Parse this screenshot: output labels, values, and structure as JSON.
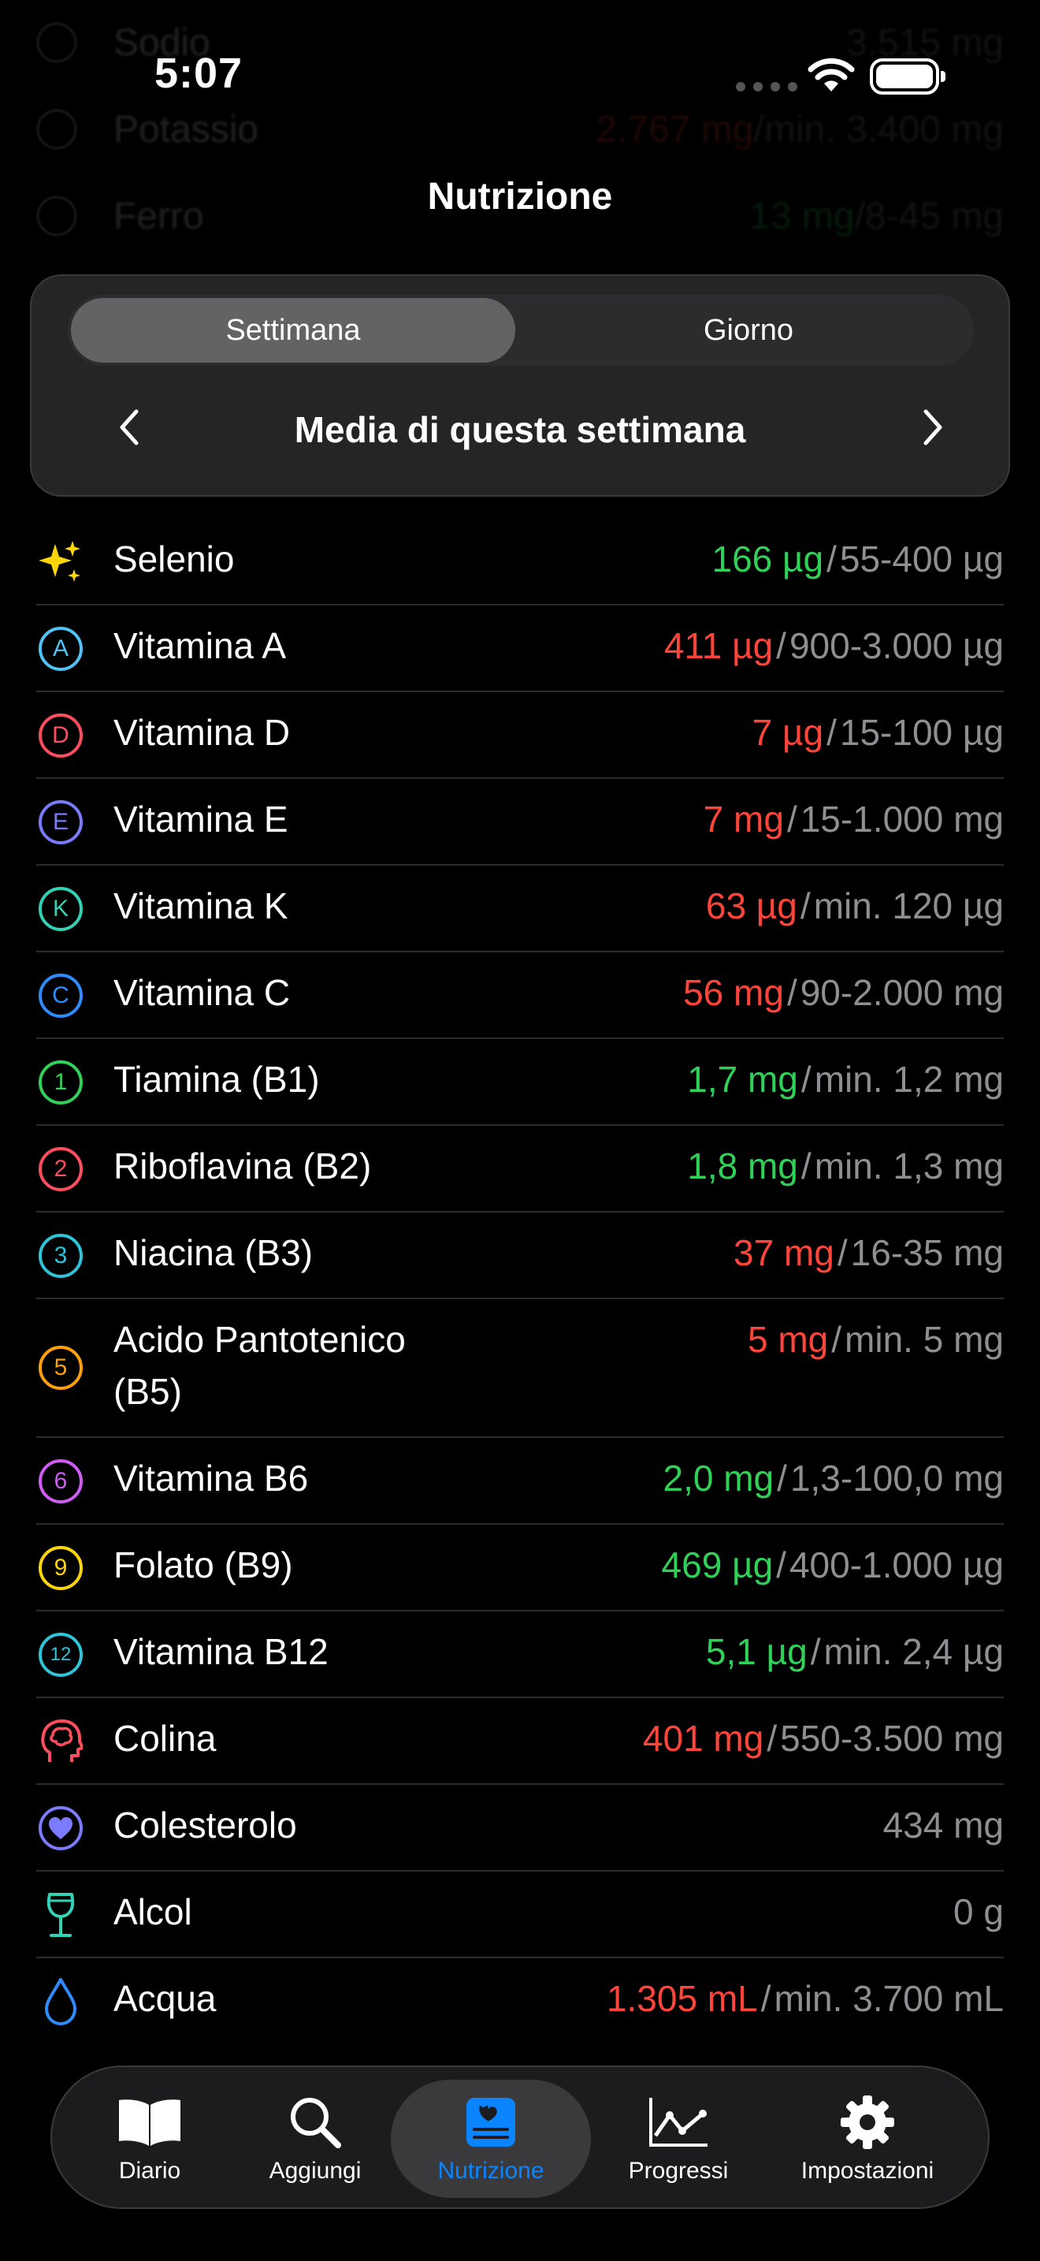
{
  "status": {
    "time": "5:07"
  },
  "nav": {
    "title": "Nutrizione"
  },
  "ghost_rows": [
    {
      "name": "Sodio",
      "value": "3.515 mg",
      "range": ""
    },
    {
      "name": "Potassio",
      "value": "2.767 mg",
      "range": "min. 3.400 mg"
    },
    {
      "name": "Ferro",
      "value": "13 mg",
      "range": "8-45 mg"
    }
  ],
  "segment": {
    "week": "Settimana",
    "day": "Giorno"
  },
  "period": {
    "label": "Media di questa settimana"
  },
  "nutrients": [
    {
      "icon": "sparkles-icon",
      "name": "Selenio",
      "value": "166 µg",
      "status": "green",
      "range": "55-400 µg"
    },
    {
      "icon": "letter-a-icon",
      "glyph": "A",
      "color": "#4fc3f7",
      "name": "Vitamina A",
      "value": "411 µg",
      "status": "red",
      "range": "900-3.000 µg"
    },
    {
      "icon": "letter-d-icon",
      "glyph": "D",
      "color": "#ff4d5e",
      "name": "Vitamina D",
      "value": "7 µg",
      "status": "red",
      "range": "15-100 µg"
    },
    {
      "icon": "letter-e-icon",
      "glyph": "E",
      "color": "#7b7bff",
      "name": "Vitamina E",
      "value": "7 mg",
      "status": "red",
      "range": "15-1.000 mg"
    },
    {
      "icon": "letter-k-icon",
      "glyph": "K",
      "color": "#30d3b5",
      "name": "Vitamina K",
      "value": "63 µg",
      "status": "red",
      "range": "min. 120 µg"
    },
    {
      "icon": "letter-c-icon",
      "glyph": "C",
      "color": "#2f8cff",
      "name": "Vitamina C",
      "value": "56 mg",
      "status": "red",
      "range": "90-2.000 mg"
    },
    {
      "icon": "number-1-icon",
      "glyph": "1",
      "color": "#30d158",
      "name": "Tiamina (B1)",
      "value": "1,7 mg",
      "status": "green",
      "range": "min. 1,2 mg"
    },
    {
      "icon": "number-2-icon",
      "glyph": "2",
      "color": "#ff4d5e",
      "name": "Riboflavina (B2)",
      "value": "1,8 mg",
      "status": "green",
      "range": "min. 1,3 mg"
    },
    {
      "icon": "number-3-icon",
      "glyph": "3",
      "color": "#2ec5d9",
      "name": "Niacina (B3)",
      "value": "37 mg",
      "status": "red",
      "range": "16-35 mg"
    },
    {
      "icon": "number-5-icon",
      "glyph": "5",
      "color": "#ff9f0a",
      "name": "Acido Pantotenico (B5)",
      "value": "5 mg",
      "status": "red",
      "range": "min. 5 mg",
      "tall": true
    },
    {
      "icon": "number-6-icon",
      "glyph": "6",
      "color": "#d05cf5",
      "name": "Vitamina B6",
      "value": "2,0 mg",
      "status": "green",
      "range": "1,3-100,0 mg"
    },
    {
      "icon": "number-9-icon",
      "glyph": "9",
      "color": "#ffd60a",
      "name": "Folato (B9)",
      "value": "469 µg",
      "status": "green",
      "range": "400-1.000 µg"
    },
    {
      "icon": "number-12-icon",
      "glyph": "12",
      "color": "#2ec5d9",
      "name": "Vitamina B12",
      "value": "5,1 µg",
      "status": "green",
      "range": "min. 2,4 µg"
    },
    {
      "icon": "brain-head-icon",
      "name": "Colina",
      "value": "401 mg",
      "status": "red",
      "range": "550-3.500 mg"
    },
    {
      "icon": "heart-circle-icon",
      "name": "Colesterolo",
      "value": "434 mg",
      "status": "gray",
      "range": ""
    },
    {
      "icon": "wine-glass-icon",
      "name": "Alcol",
      "value": "0 g",
      "status": "gray",
      "range": ""
    },
    {
      "icon": "water-drop-icon",
      "name": "Acqua",
      "value": "1.305 mL",
      "status": "red",
      "range": "min. 3.700 mL"
    }
  ],
  "tabs": [
    {
      "icon": "book-icon",
      "label": "Diario"
    },
    {
      "icon": "search-icon",
      "label": "Aggiungi"
    },
    {
      "icon": "nutrition-label-icon",
      "label": "Nutrizione",
      "active": true
    },
    {
      "icon": "chart-line-icon",
      "label": "Progressi"
    },
    {
      "icon": "gear-icon",
      "label": "Impostazioni"
    }
  ],
  "colors": {
    "red": "#ff453a",
    "green": "#30d158",
    "gray": "#8e8e93",
    "accent": "#0a84ff"
  }
}
